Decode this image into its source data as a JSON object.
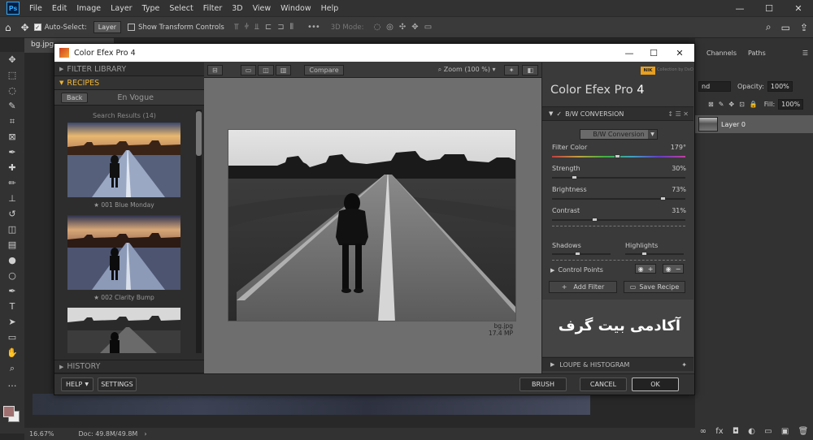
{
  "photoshop": {
    "logo": "Ps",
    "menus": [
      "File",
      "Edit",
      "Image",
      "Layer",
      "Type",
      "Select",
      "Filter",
      "3D",
      "View",
      "Window",
      "Help"
    ],
    "window_controls": [
      "—",
      "☐",
      "✕"
    ],
    "options": {
      "auto_select_label": "Auto-Select:",
      "auto_select_value": "Layer",
      "transform_label": "Show Transform Controls",
      "mode_3d_label": "3D Mode:"
    },
    "doc_tab": "bg.jpg",
    "status": {
      "zoom": "16.67%",
      "doc": "Doc: 49.8M/49.8M"
    },
    "panels": {
      "tabs": [
        "Channels",
        "Paths"
      ],
      "blend_mode": "nd",
      "opacity_label": "Opacity:",
      "opacity_value": "100%",
      "fill_label": "Fill:",
      "fill_value": "100%",
      "layer_name": "Layer 0",
      "bottom_icons": [
        "∞",
        "fx",
        "◘",
        "◐",
        "▭",
        "▣",
        "🗑"
      ]
    }
  },
  "plugin": {
    "title": "Color Efex Pro 4",
    "title_controls": [
      "—",
      "☐",
      "✕"
    ],
    "left": {
      "filter_library": "FILTER LIBRARY",
      "recipes": "RECIPES",
      "back": "Back",
      "recipe_group": "En Vogue",
      "search_results": "Search Results (14)",
      "items": [
        {
          "caption": "★ 001 Blue Monday"
        },
        {
          "caption": "★ 002 Clarity Bump"
        },
        {
          "caption": ""
        }
      ],
      "history": "HISTORY"
    },
    "center": {
      "compare": "Compare",
      "zoom": "Zoom (100 %)",
      "photo_name": "bg.jpg",
      "photo_size": "17.4 MP"
    },
    "right": {
      "brand": "Color Efex Pro",
      "brand_num": "4",
      "nik_badge": "NIK",
      "nik_text": "Collection by DxO",
      "filter_title": "B/W CONVERSION",
      "filter_head_icons": "↕ ☰ ✕",
      "method": "B/W Conversion",
      "sliders": [
        {
          "label": "Filter Color",
          "value": "179°",
          "fraction": 0.49
        },
        {
          "label": "Strength",
          "value": "30%",
          "fraction": 0.15
        },
        {
          "label": "Brightness",
          "value": "73%",
          "fraction": 0.85
        },
        {
          "label": "Contrast",
          "value": "31%",
          "fraction": 0.31
        }
      ],
      "shadows": "Shadows",
      "highlights": "Highlights",
      "control_points": "Control Points",
      "add_filter": "Add Filter",
      "save_recipe": "Save Recipe",
      "academy": "آکادمی بیت گرف",
      "loupe": "LOUPE & HISTOGRAM"
    },
    "bottom": {
      "help": "HELP",
      "settings": "SETTINGS",
      "brush": "BRUSH",
      "cancel": "CANCEL",
      "ok": "OK"
    }
  }
}
